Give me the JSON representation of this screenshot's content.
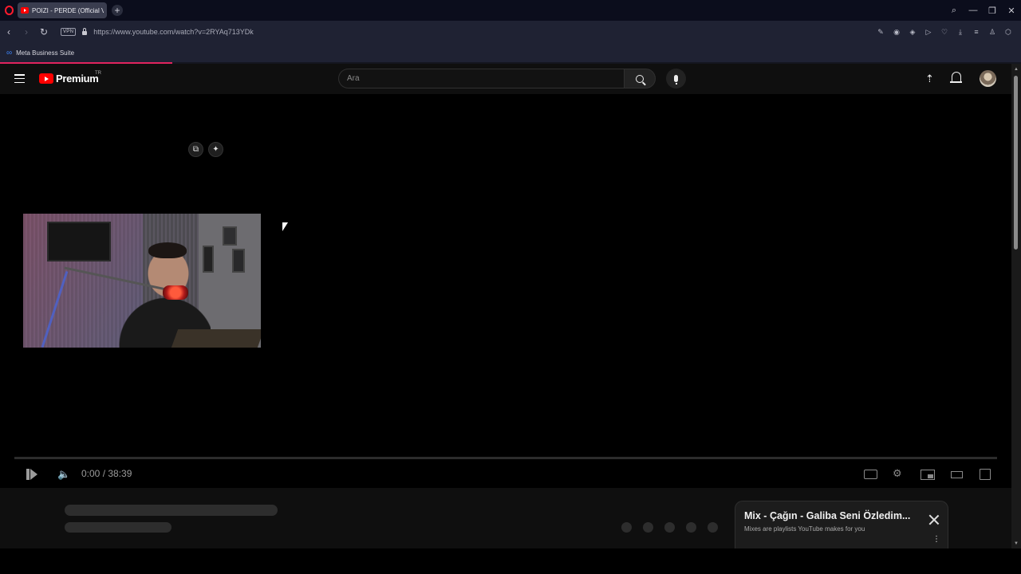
{
  "browser": {
    "tab_title": "POIZI - PERDE (Official Video)",
    "new_tab_symbol": "+",
    "url": "https://www.youtube.com/watch?v=2RYAq713YDk",
    "vpn_label": "VPN",
    "bookmark_label": "Meta Business Suite",
    "accent": "#e0245e"
  },
  "youtube": {
    "logo_text": "Premium",
    "country_code": "TR",
    "search_placeholder": "Ara",
    "brand_color": "#ff0000"
  },
  "player": {
    "time_display": "0:00 / 38:39",
    "progress": 0
  },
  "mix_panel": {
    "title": "Mix - Çağın - Galiba Seni Özledim...",
    "subtitle": "Mixes are playlists YouTube makes for you"
  }
}
